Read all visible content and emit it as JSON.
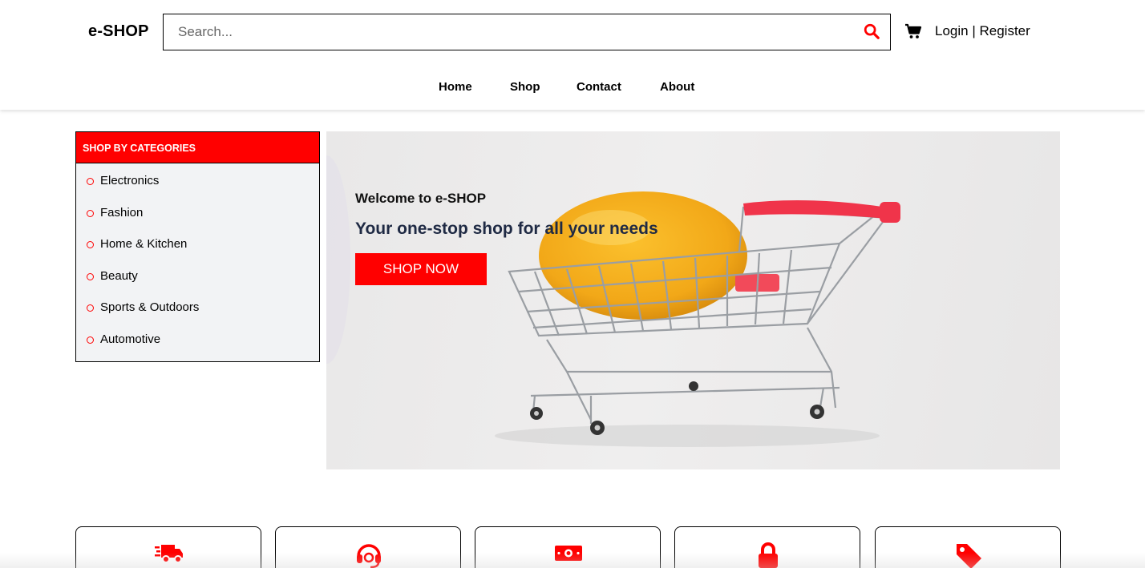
{
  "header": {
    "logo": "e-SHOP",
    "search": {
      "placeholder": "Search...",
      "value": ""
    },
    "auth": {
      "login": "Login",
      "separator": " | ",
      "register": "Register"
    }
  },
  "nav": {
    "items": [
      "Home",
      "Shop",
      "Contact",
      "About"
    ]
  },
  "categories": {
    "title": "SHOP BY CATEGORIES",
    "items": [
      "Electronics",
      "Fashion",
      "Home & Kitchen",
      "Beauty",
      "Sports & Outdoors",
      "Automotive"
    ]
  },
  "hero": {
    "welcome": "Welcome to e-SHOP",
    "tagline": "Your one-stop shop for all your needs",
    "button": "SHOP NOW"
  },
  "features": {
    "icons": [
      "truck-icon",
      "headset-icon",
      "money-bill-icon",
      "lock-icon",
      "tag-icon"
    ]
  },
  "colors": {
    "accent": "#ff0000",
    "text": "#000000",
    "tagline": "#1f2a44",
    "sidebar_bg": "#f2f3f5"
  }
}
